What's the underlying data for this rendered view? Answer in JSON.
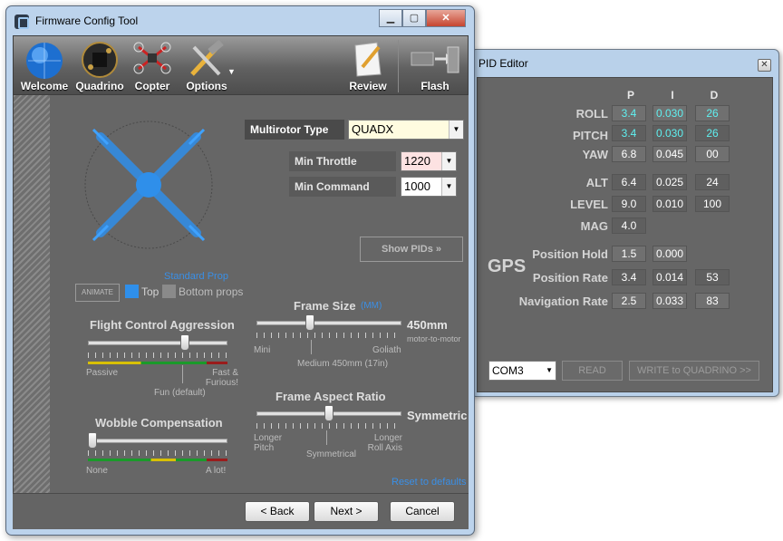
{
  "main_window": {
    "title": "Firmware Config Tool",
    "caption": {
      "minimize": "▁",
      "maximize": "▢",
      "close": "✕"
    },
    "toolbar": {
      "welcome": "Welcome",
      "quadrino": "Quadrino",
      "copter": "Copter",
      "options": "Options",
      "review": "Review",
      "flash": "Flash"
    },
    "multirotor": {
      "label": "Multirotor Type",
      "value": "QUADX"
    },
    "min_throttle": {
      "label": "Min Throttle",
      "value": "1220"
    },
    "min_command": {
      "label": "Min Command",
      "value": "1000"
    },
    "show_pids": "Show PIDs »",
    "animate": "ANIMATE",
    "prop": {
      "standard": "Standard Prop",
      "top": "Top",
      "bottom": "Bottom props"
    },
    "aggression": {
      "title": "Flight Control Aggression",
      "passive": "Passive",
      "fast": "Fast &\nFurious!",
      "fun": "Fun (default)",
      "value_fraction": 0.71
    },
    "wobble": {
      "title": "Wobble Compensation",
      "none": "None",
      "alot": "A lot!",
      "value_fraction": 0.0
    },
    "frame_size": {
      "title": "Frame Size",
      "unit": "(MM)",
      "value": "450mm",
      "sub": "motor-to-motor",
      "mini": "Mini",
      "goliath": "Goliath",
      "medium": "Medium 450mm (17in)",
      "value_fraction": 0.36
    },
    "frame_aspect": {
      "title": "Frame Aspect Ratio",
      "value": "Symmetric",
      "longer_pitch": "Longer\nPitch",
      "symmetrical": "Symmetrical",
      "longer_roll": "Longer\nRoll Axis",
      "value_fraction": 0.5
    },
    "reset": "Reset to defaults",
    "nav": {
      "back": "< Back",
      "next": "Next >",
      "cancel": "Cancel"
    }
  },
  "pid_window": {
    "title": "PID Editor",
    "close": "✕",
    "headers": [
      "P",
      "I",
      "D"
    ],
    "rows": [
      {
        "label": "ROLL",
        "p": "3.4",
        "i": "0.030",
        "d": "26"
      },
      {
        "label": "PITCH",
        "p": "3.4",
        "i": "0.030",
        "d": "26"
      },
      {
        "label": "YAW",
        "p": "6.8",
        "i": "0.045",
        "d": "00"
      },
      {
        "label": "ALT",
        "p": "6.4",
        "i": "0.025",
        "d": "24"
      },
      {
        "label": "LEVEL",
        "p": "9.0",
        "i": "0.010",
        "d": "100"
      },
      {
        "label": "MAG",
        "p": "4.0"
      }
    ],
    "gps": {
      "label": "GPS",
      "position_hold": {
        "label": "Position Hold",
        "p": "1.5",
        "i": "0.000"
      },
      "position_rate": {
        "label": "Position Rate",
        "p": "3.4",
        "i": "0.014",
        "d": "53"
      },
      "navigation_rate": {
        "label": "Navigation Rate",
        "p": "2.5",
        "i": "0.033",
        "d": "83"
      }
    },
    "port": "COM3",
    "read": "READ",
    "write": "WRITE to QUADRINO >>"
  },
  "colors": {
    "client_bg": "#666666",
    "accent_blue": "#2f8fea",
    "cyan_value": "#5ff0f0"
  }
}
